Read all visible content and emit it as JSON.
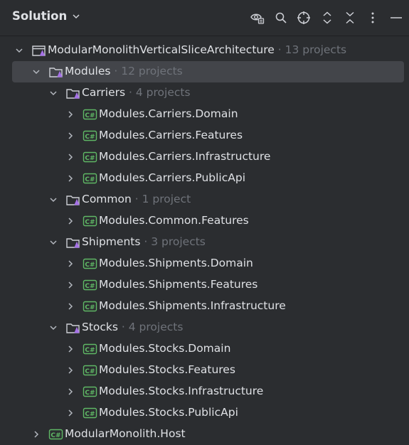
{
  "header": {
    "title": "Solution",
    "icons": [
      "eye-settings-icon",
      "search-icon",
      "target-icon",
      "expand-all-icon",
      "collapse-all-icon",
      "more-icon",
      "minimize-icon"
    ]
  },
  "tree": [
    {
      "label": "ModularMonolithVerticalSliceArchitecture",
      "meta": "· 13 projects",
      "type": "solution",
      "expanded": true
    },
    {
      "label": "Modules",
      "meta": "· 12 projects",
      "type": "folder",
      "expanded": true,
      "selected": true
    },
    {
      "label": "Carriers",
      "meta": "· 4 projects",
      "type": "folder",
      "expanded": true
    },
    {
      "label": "Modules.Carriers.Domain",
      "meta": "",
      "type": "csharp",
      "expanded": false
    },
    {
      "label": "Modules.Carriers.Features",
      "meta": "",
      "type": "csharp",
      "expanded": false
    },
    {
      "label": "Modules.Carriers.Infrastructure",
      "meta": "",
      "type": "csharp",
      "expanded": false
    },
    {
      "label": "Modules.Carriers.PublicApi",
      "meta": "",
      "type": "csharp",
      "expanded": false
    },
    {
      "label": "Common",
      "meta": "· 1 project",
      "type": "folder",
      "expanded": true
    },
    {
      "label": "Modules.Common.Features",
      "meta": "",
      "type": "csharp",
      "expanded": false
    },
    {
      "label": "Shipments",
      "meta": "· 3 projects",
      "type": "folder",
      "expanded": true
    },
    {
      "label": "Modules.Shipments.Domain",
      "meta": "",
      "type": "csharp",
      "expanded": false
    },
    {
      "label": "Modules.Shipments.Features",
      "meta": "",
      "type": "csharp",
      "expanded": false
    },
    {
      "label": "Modules.Shipments.Infrastructure",
      "meta": "",
      "type": "csharp",
      "expanded": false
    },
    {
      "label": "Stocks",
      "meta": "· 4 projects",
      "type": "folder",
      "expanded": true
    },
    {
      "label": "Modules.Stocks.Domain",
      "meta": "",
      "type": "csharp",
      "expanded": false
    },
    {
      "label": "Modules.Stocks.Features",
      "meta": "",
      "type": "csharp",
      "expanded": false
    },
    {
      "label": "Modules.Stocks.Infrastructure",
      "meta": "",
      "type": "csharp",
      "expanded": false
    },
    {
      "label": "Modules.Stocks.PublicApi",
      "meta": "",
      "type": "csharp",
      "expanded": false
    },
    {
      "label": "ModularMonolith.Host",
      "meta": "",
      "type": "csharp",
      "expanded": false
    }
  ],
  "colors": {
    "csharp": "#5fb865",
    "folder": "#ced0d6",
    "accent": "#a571e6"
  }
}
